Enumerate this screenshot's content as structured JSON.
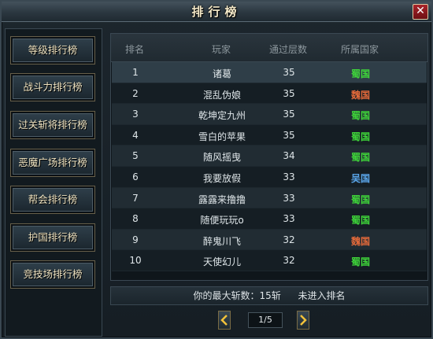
{
  "window": {
    "title": "排行榜",
    "close_label": "✕"
  },
  "sidebar": {
    "items": [
      {
        "label": "等级排行榜"
      },
      {
        "label": "战斗力排行榜"
      },
      {
        "label": "过关斩将排行榜"
      },
      {
        "label": "恶魔广场排行榜"
      },
      {
        "label": "帮会排行榜"
      },
      {
        "label": "护国排行榜"
      },
      {
        "label": "竞技场排行榜"
      }
    ]
  },
  "table": {
    "headers": {
      "rank": "排名",
      "player": "玩家",
      "level": "通过层数",
      "country": "所属国家"
    },
    "rows": [
      {
        "rank": "1",
        "player": "诸葛",
        "level": "35",
        "country": "蜀国",
        "country_color": "#3fd63a"
      },
      {
        "rank": "2",
        "player": "混乱伪娘",
        "level": "35",
        "country": "魏国",
        "country_color": "#e2693a"
      },
      {
        "rank": "3",
        "player": "乾坤定九州",
        "level": "35",
        "country": "蜀国",
        "country_color": "#3fd63a"
      },
      {
        "rank": "4",
        "player": "雪白的苹果",
        "level": "35",
        "country": "蜀国",
        "country_color": "#3fd63a"
      },
      {
        "rank": "5",
        "player": "随风摇曳",
        "level": "34",
        "country": "蜀国",
        "country_color": "#3fd63a"
      },
      {
        "rank": "6",
        "player": "我要放假",
        "level": "33",
        "country": "吴国",
        "country_color": "#5aa6ea"
      },
      {
        "rank": "7",
        "player": "露露来撸撸",
        "level": "33",
        "country": "蜀国",
        "country_color": "#3fd63a"
      },
      {
        "rank": "8",
        "player": "随便玩玩o",
        "level": "33",
        "country": "蜀国",
        "country_color": "#3fd63a"
      },
      {
        "rank": "9",
        "player": "醉鬼川飞",
        "level": "32",
        "country": "魏国",
        "country_color": "#e2693a"
      },
      {
        "rank": "10",
        "player": "天使幻儿",
        "level": "32",
        "country": "蜀国",
        "country_color": "#3fd63a"
      }
    ]
  },
  "status": {
    "best_label": "你的最大斩数：15斩",
    "rank_status": "未进入排名"
  },
  "pagination": {
    "page_label": "1/5",
    "prev_icon": "chevron-left-icon",
    "next_icon": "chevron-right-icon"
  },
  "colors": {
    "shu": "#3fd63a",
    "wei": "#e2693a",
    "wu": "#5aa6ea",
    "accent_gold": "#efe3c0"
  }
}
